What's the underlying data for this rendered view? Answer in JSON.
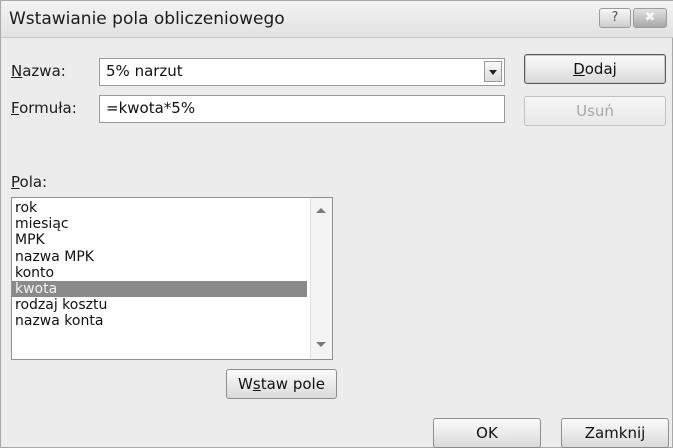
{
  "dialog": {
    "title": "Wstawianie pola obliczeniowego",
    "help_label": "?",
    "close_label": "✖"
  },
  "name": {
    "label_key": "N",
    "label_rest": "azwa:",
    "value": "5% narzut"
  },
  "formula": {
    "label_key": "F",
    "label_rest": "ormuła:",
    "value": "=kwota*5%"
  },
  "buttons": {
    "add_key": "D",
    "add_rest": "odaj",
    "remove": "Usuń",
    "insert_pre": "W",
    "insert_key": "s",
    "insert_rest": "taw pole",
    "ok": "OK",
    "close": "Zamknij"
  },
  "fields": {
    "label_key": "P",
    "label_rest": "ola:",
    "items": [
      "rok",
      "miesiąc",
      "MPK",
      "nazwa MPK",
      "konto",
      "kwota",
      "rodzaj kosztu",
      "nazwa konta"
    ],
    "selected": "kwota"
  },
  "colors": {
    "selection": "#8a8a8a",
    "dialog_bg": "#ececec"
  }
}
